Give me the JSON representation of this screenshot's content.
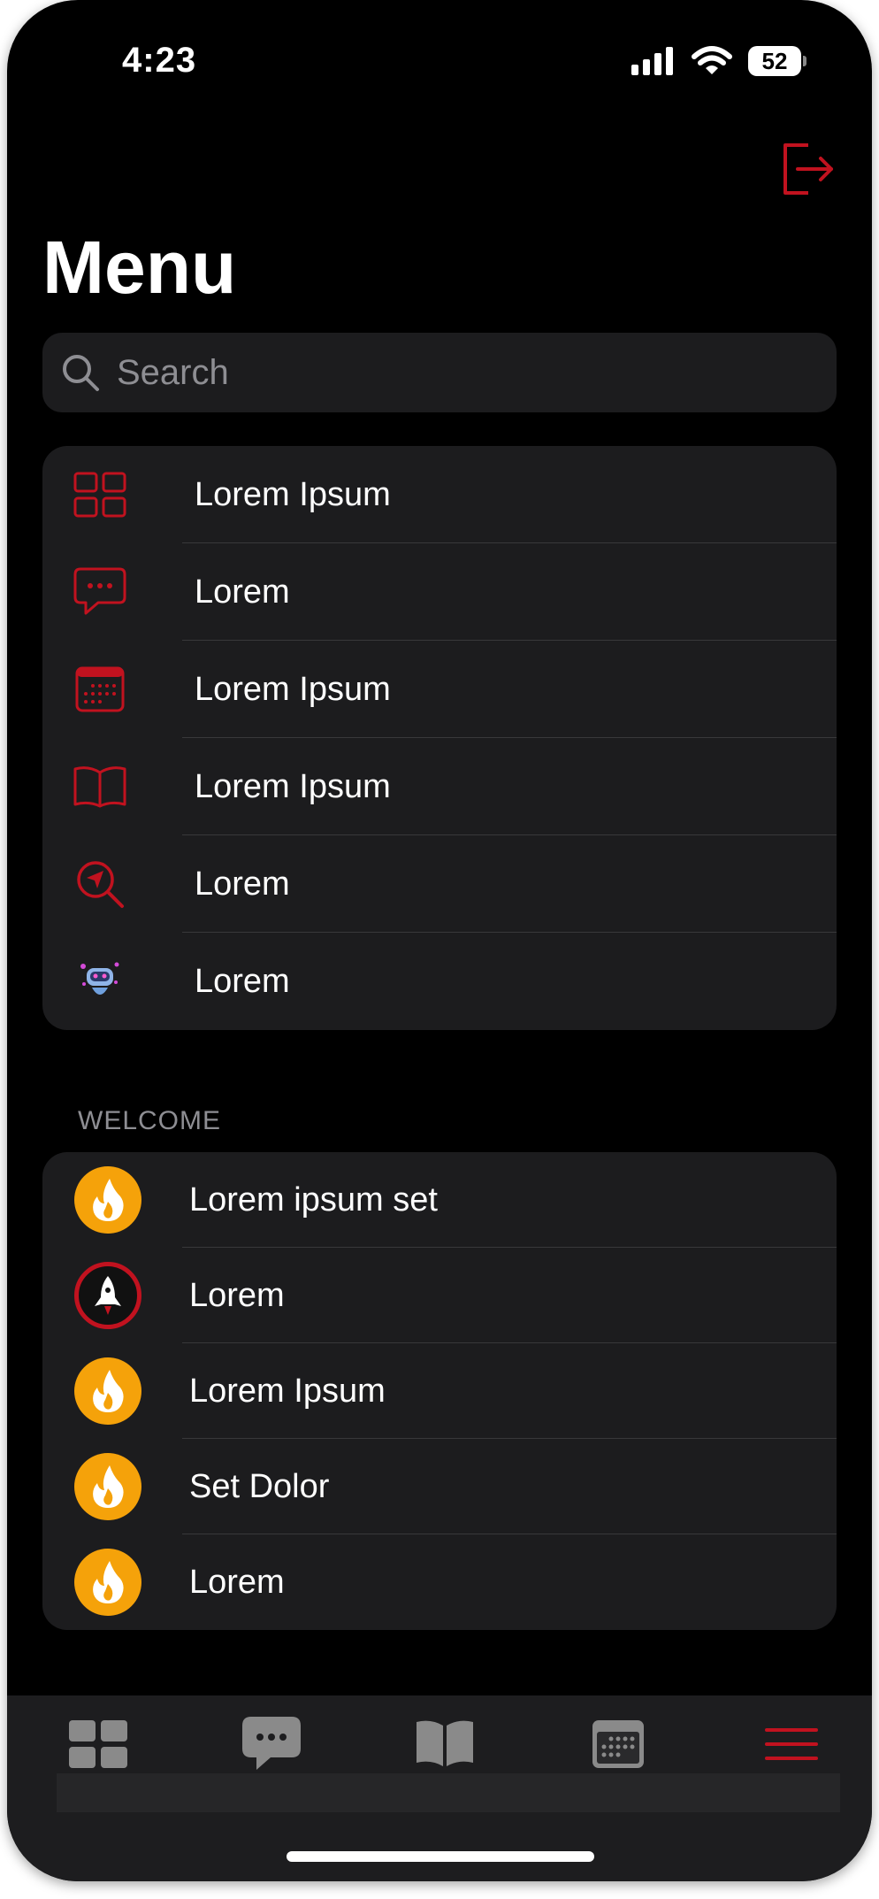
{
  "status_bar": {
    "time": "4:23",
    "battery": "52",
    "icons": [
      "cellular-signal-icon",
      "wifi-icon",
      "battery-icon"
    ]
  },
  "header": {
    "title": "Menu",
    "logout_icon": "logout-icon"
  },
  "search": {
    "placeholder": "Search",
    "icon": "search-icon"
  },
  "main_menu": {
    "items": [
      {
        "label": "Lorem Ipsum",
        "icon": "grid-icon"
      },
      {
        "label": "Lorem",
        "icon": "chat-bubble-icon"
      },
      {
        "label": "Lorem Ipsum",
        "icon": "calendar-icon"
      },
      {
        "label": "Lorem Ipsum",
        "icon": "book-icon"
      },
      {
        "label": "Lorem",
        "icon": "location-search-icon"
      },
      {
        "label": "Lorem",
        "icon": "robot-icon"
      }
    ]
  },
  "welcome": {
    "header": "WELCOME",
    "items": [
      {
        "label": "Lorem ipsum set",
        "icon": "flame-icon"
      },
      {
        "label": "Lorem",
        "icon": "rocket-badge-icon"
      },
      {
        "label": "Lorem Ipsum",
        "icon": "flame-icon"
      },
      {
        "label": "Set Dolor",
        "icon": "flame-icon"
      },
      {
        "label": "Lorem",
        "icon": "flame-icon"
      }
    ]
  },
  "tab_bar": {
    "tabs": [
      {
        "icon": "grid-icon",
        "active": false
      },
      {
        "icon": "chat-bubble-icon",
        "active": false
      },
      {
        "icon": "book-icon",
        "active": false
      },
      {
        "icon": "calendar-icon",
        "active": false
      },
      {
        "icon": "hamburger-menu-icon",
        "active": true
      }
    ]
  },
  "colors": {
    "accent": "#c1121f",
    "background": "#000000",
    "card": "#1c1c1e",
    "secondary_text": "#8e8e93",
    "flame": "#f5a20a",
    "inactive_tab": "#8a8a8a"
  }
}
